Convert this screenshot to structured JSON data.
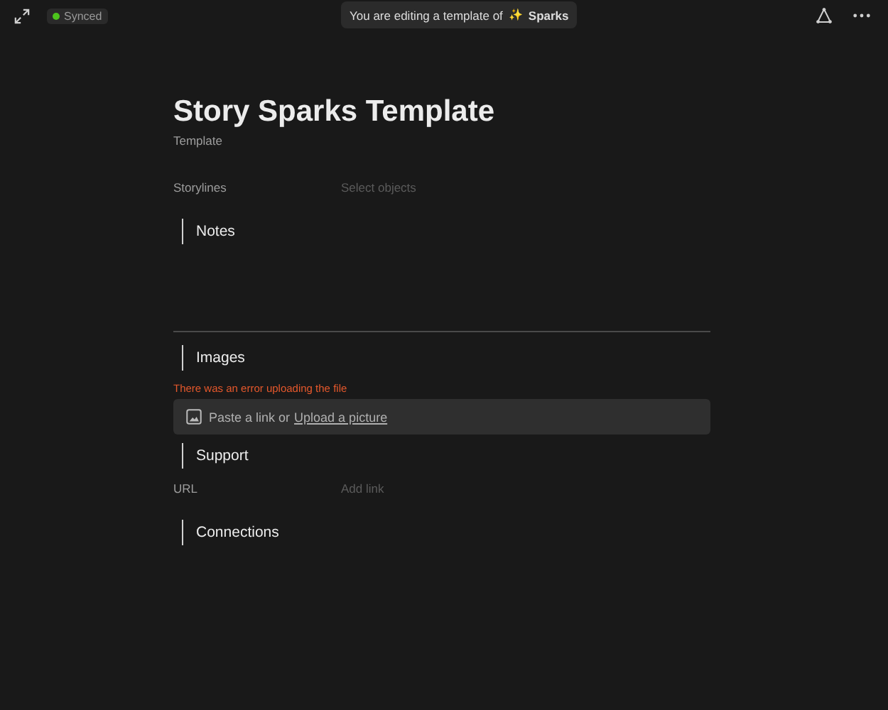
{
  "topbar": {
    "status": {
      "label": "Synced",
      "on": true
    },
    "banner": {
      "text": "You are editing a template of",
      "emoji": "✨",
      "name": "Sparks"
    }
  },
  "page": {
    "title": "Story Sparks Template",
    "subtitle": "Template"
  },
  "blocks": [
    {
      "kind": "property",
      "label": "Storylines",
      "placeholder": "Select objects"
    },
    {
      "kind": "heading",
      "text": "Notes"
    },
    {
      "kind": "notes"
    },
    {
      "kind": "heading",
      "text": "Images"
    },
    {
      "kind": "error",
      "text": "There was an error uploading the file"
    },
    {
      "kind": "upload",
      "text": "Paste a link or",
      "link": "Upload a picture"
    },
    {
      "kind": "heading",
      "text": "Support"
    },
    {
      "kind": "property",
      "label": "URL",
      "placeholder": "Add link"
    },
    {
      "kind": "heading",
      "text": "Connections"
    }
  ]
}
